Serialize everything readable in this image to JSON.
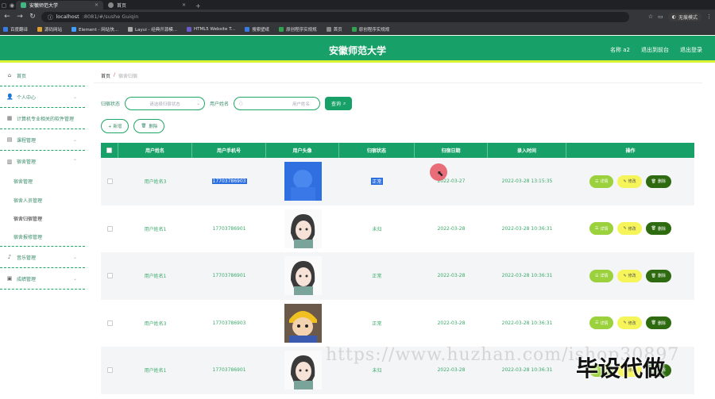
{
  "browser": {
    "tabs": [
      {
        "title": "安徽师范大学",
        "active": true
      },
      {
        "title": "首页",
        "active": false
      }
    ],
    "url_host": "localhost",
    "url_rest": ":8081/#/sushe Guiqin",
    "incognito_label": "无痕模式",
    "bookmarks": [
      "百度翻译",
      "源码网站",
      "Element - 网站快...",
      "Layui - 经典开源模...",
      "HTML5 Website T...",
      "搜索壁纸",
      "原创程序实规规",
      "首页",
      "原创程序实规规"
    ]
  },
  "header": {
    "title": "安徽师范大学",
    "user_label": "名称 a2",
    "back_label": "退出到前台",
    "logout_label": "退出登录"
  },
  "sidebar": {
    "items": [
      {
        "label": "首页",
        "icon": "home-icon"
      },
      {
        "label": "个人中心",
        "icon": "user-icon"
      },
      {
        "label": "计算机专业相关的软件管理",
        "icon": "grid-icon"
      },
      {
        "label": "课程管理",
        "icon": "book-icon"
      },
      {
        "label": "宿舍管理",
        "icon": "building-icon"
      },
      {
        "label": "音乐管理",
        "icon": "music-icon"
      },
      {
        "label": "成绩管理",
        "icon": "chart-icon"
      }
    ],
    "submenu": [
      "宿舍管理",
      "宿舍人员管理",
      "宿舍归宿管理",
      "宿舍报修管理"
    ]
  },
  "breadcrumb": {
    "home": "首页",
    "sep": "/",
    "current": "宿舍归宿"
  },
  "search": {
    "status_label": "归宿状态",
    "status_placeholder": "请选择归宿状态",
    "name_label": "用户姓名",
    "name_placeholder": "用户姓名",
    "query_label": "查询"
  },
  "actions": {
    "add_label": "+ 新增",
    "delete_label": "删除"
  },
  "table": {
    "headers": [
      "用户姓名",
      "用户手机号",
      "用户头像",
      "归宿状态",
      "归宿日期",
      "录入时间",
      "操作"
    ],
    "rows": [
      {
        "name": "用户姓名3",
        "phone": "17703786903",
        "avatar": "boy-blue",
        "status": "正常",
        "date": "2022-03-27",
        "created": "2022-03-28 13:15:35"
      },
      {
        "name": "用户姓名1",
        "phone": "17703786901",
        "avatar": "girl",
        "status": "未归",
        "date": "2022-03-28",
        "created": "2022-03-28 10:36:31"
      },
      {
        "name": "用户姓名1",
        "phone": "17703786901",
        "avatar": "girl",
        "status": "正常",
        "date": "2022-03-28",
        "created": "2022-03-28 10:36:31"
      },
      {
        "name": "用户姓名3",
        "phone": "17703786903",
        "avatar": "boy",
        "status": "正常",
        "date": "2022-03-28",
        "created": "2022-03-28 10:36:31"
      },
      {
        "name": "用户姓名1",
        "phone": "17703786901",
        "avatar": "girl",
        "status": "未归",
        "date": "2022-03-28",
        "created": "2022-03-28 10:36:31"
      }
    ],
    "op_detail": "详情",
    "op_edit": "修改",
    "op_delete": "删除"
  },
  "watermark": {
    "url": "https://www.huzhan.com/ishop30897",
    "brand": "毕设代做"
  }
}
